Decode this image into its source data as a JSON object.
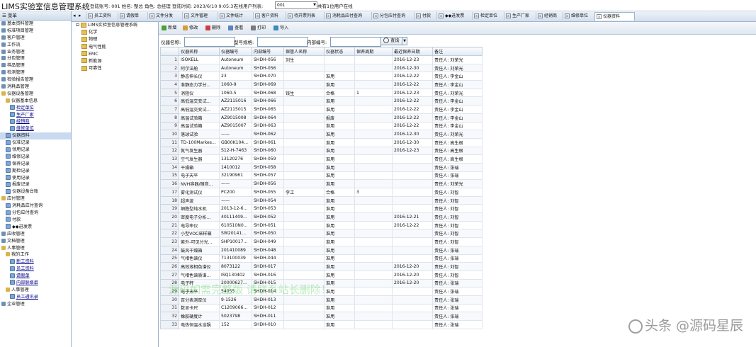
{
  "app": {
    "title": "LIMS实验室信息管理系统",
    "user_info": "登陆账号: 001 姓名: 整总 角色: 总经理 登陆时间: 2023/6/10 9:05:37",
    "online_label": "在线用户列表:",
    "online_selected": "001",
    "online_count": "共有1位用户在线"
  },
  "sidebar": {
    "header": "菜单",
    "items": [
      {
        "label": "基本资料管理",
        "level": 1,
        "icon": "database-icon"
      },
      {
        "label": "标准项目管理",
        "level": 1,
        "icon": "database-icon"
      },
      {
        "label": "客户管理",
        "level": 1,
        "icon": "database-icon"
      },
      {
        "label": "工作流",
        "level": 1,
        "icon": "database-icon"
      },
      {
        "label": "业务管理",
        "level": 1,
        "icon": "database-icon"
      },
      {
        "label": "分包管理",
        "level": 1,
        "icon": "database-icon"
      },
      {
        "label": "样品管理",
        "level": 1,
        "icon": "database-icon"
      },
      {
        "label": "检测管理",
        "level": 1,
        "icon": "database-icon"
      },
      {
        "label": "检验报告管理",
        "level": 1,
        "icon": "database-icon"
      },
      {
        "label": "消耗品管理",
        "level": 1,
        "icon": "database-icon"
      },
      {
        "label": "仪器设备管理",
        "level": 1,
        "icon": "folder-open-icon"
      },
      {
        "label": "仪器基本信息",
        "level": 2,
        "icon": "folder-open-icon"
      },
      {
        "label": "检定单位",
        "level": 3,
        "icon": "document-icon"
      },
      {
        "label": "生产厂家",
        "level": 3,
        "icon": "document-icon"
      },
      {
        "label": "经销商",
        "level": 3,
        "icon": "document-icon"
      },
      {
        "label": "维修单位",
        "level": 3,
        "icon": "document-icon"
      },
      {
        "label": "仪器资料",
        "level": 2,
        "icon": "document-icon",
        "selected": true
      },
      {
        "label": "仪准记录",
        "level": 2,
        "icon": "document-icon"
      },
      {
        "label": "领用记录",
        "level": 2,
        "icon": "document-icon"
      },
      {
        "label": "维修记录",
        "level": 2,
        "icon": "document-icon"
      },
      {
        "label": "保养记录",
        "level": 2,
        "icon": "document-icon"
      },
      {
        "label": "期检记录",
        "level": 2,
        "icon": "document-icon"
      },
      {
        "label": "使用记录",
        "level": 2,
        "icon": "document-icon"
      },
      {
        "label": "报废记录",
        "level": 2,
        "icon": "document-icon"
      },
      {
        "label": "仪器设备台账",
        "level": 2,
        "icon": "document-icon"
      },
      {
        "label": "应付管理",
        "level": 1,
        "icon": "folder-open-icon"
      },
      {
        "label": "消耗品应付查询",
        "level": 2,
        "icon": "document-icon"
      },
      {
        "label": "分包应付查询",
        "level": 2,
        "icon": "document-icon"
      },
      {
        "label": "付款",
        "level": 2,
        "icon": "document-icon"
      },
      {
        "label": "◆◆进发票",
        "level": 2,
        "icon": "document-icon"
      },
      {
        "label": "应收管理",
        "level": 1,
        "icon": "database-icon"
      },
      {
        "label": "文档管理",
        "level": 1,
        "icon": "database-icon"
      },
      {
        "label": "人事管理",
        "level": 1,
        "icon": "folder-open-icon"
      },
      {
        "label": "我的工作",
        "level": 2,
        "icon": "folder-open-icon"
      },
      {
        "label": "新工资料",
        "level": 3,
        "icon": "document-icon"
      },
      {
        "label": "员工资料",
        "level": 3,
        "icon": "document-icon"
      },
      {
        "label": "请假单",
        "level": 3,
        "icon": "document-icon"
      },
      {
        "label": "内部联络单",
        "level": 3,
        "icon": "document-icon"
      },
      {
        "label": "人事管理",
        "level": 2,
        "icon": "folder-closed-icon"
      },
      {
        "label": "员工通讯录",
        "level": 3,
        "icon": "document-icon"
      },
      {
        "label": "企业管理",
        "level": 1,
        "icon": "database-icon"
      }
    ]
  },
  "tabs": [
    {
      "label": "员工资料"
    },
    {
      "label": "请假单"
    },
    {
      "label": "文件分发"
    },
    {
      "label": "文件管理"
    },
    {
      "label": "文件统计"
    },
    {
      "label": "客户资料"
    },
    {
      "label": "待开票列表"
    },
    {
      "label": "消耗品应付查询"
    },
    {
      "label": "分包应付查询"
    },
    {
      "label": "付款"
    },
    {
      "label": "◆◆进发票"
    },
    {
      "label": "检定单位"
    },
    {
      "label": "生产厂家"
    },
    {
      "label": "经销商"
    },
    {
      "label": "维修单位"
    },
    {
      "label": "仪器资料",
      "active": true
    }
  ],
  "tree": {
    "root": "LIMS实验室信息管理系统",
    "children": [
      "化学",
      "物理",
      "电气性能",
      "EMC",
      "新能源",
      "可靠性"
    ]
  },
  "toolbar": {
    "new": "新增",
    "edit": "修改",
    "delete": "删除",
    "view": "查看",
    "print": "打印",
    "import": "导入"
  },
  "filter": {
    "name_label": "仪器名称:",
    "model_label": "型号规格:",
    "internal_label": "内部编号:",
    "query_button": "查询",
    "name_value": "",
    "model_value": "",
    "internal_value": ""
  },
  "table": {
    "columns": [
      "",
      "仪器名称",
      "仪器编号",
      "内部编号",
      "保管人名称",
      "仪器状态",
      "保养周期",
      "最近保养日期",
      "备注"
    ],
    "rows": [
      [
        "1",
        "ISOKELL",
        "Autoneum",
        "SHDH-056",
        "刘生",
        "",
        "",
        "2016-12-23",
        "责任人: 刘荣光"
      ],
      [
        "2",
        "阿尔法舱",
        "Autoneum",
        "SHDH-056",
        "",
        "",
        "",
        "2016-12-30",
        "责任人: 刘荣光"
      ],
      [
        "3",
        "静态伸长仪",
        "23",
        "SHDH-070",
        "",
        "准用",
        "",
        "2016-12-22",
        "责任人: 李金山"
      ],
      [
        "4",
        "准静态力学分...",
        "1060-9",
        "SHDH-069",
        "",
        "准用",
        "",
        "2016-12-22",
        "责任人: 李金山"
      ],
      [
        "5",
        "消阻仪",
        "1060-5",
        "SHDH-068",
        "钱生",
        "合格",
        "1",
        "2016-12-23",
        "责任人: 刘荣光"
      ],
      [
        "6",
        "高低温交变试...",
        "AZ2115016",
        "SHDH-066",
        "",
        "准用",
        "",
        "2016-12-22",
        "责任人: 李金山"
      ],
      [
        "7",
        "高低温交变试...",
        "AZ2115015",
        "SHDH-065",
        "",
        "准用",
        "",
        "2016-12-22",
        "责任人: 李金山"
      ],
      [
        "8",
        "高温试验箱",
        "AZ9015008",
        "SHDH-064",
        "",
        "报废",
        "",
        "2016-12-22",
        "责任人: 李金山"
      ],
      [
        "9",
        "高温试验箱",
        "AZ9015007",
        "SHDH-063",
        "",
        "准用",
        "",
        "2016-12-22",
        "责任人: 李金山"
      ],
      [
        "10",
        "落球试验",
        "——",
        "SHDH-062",
        "",
        "准用",
        "",
        "2016-12-30",
        "责任人: 刘荣光"
      ],
      [
        "11",
        "TD-100Markes...",
        "GB00K104...",
        "SHDH-061",
        "",
        "准用",
        "",
        "2016-12-30",
        "责任人: 高生根"
      ],
      [
        "12",
        "氮气发生器",
        "S12-H-7463",
        "SHDH-060",
        "",
        "准用",
        "",
        "2016-12-23",
        "责任人: 高生根"
      ],
      [
        "13",
        "空气发生器",
        "13120276",
        "SHDH-059",
        "",
        "准用",
        "",
        "",
        "责任人: 高生根"
      ],
      [
        "14",
        "干燥箱",
        "1410012",
        "SHDH-058",
        "",
        "准用",
        "",
        "",
        "责任人: 张瑞"
      ],
      [
        "15",
        "电子天平",
        "32190961",
        "SHDH-057",
        "",
        "准用",
        "",
        "",
        "责任人: 张瑞"
      ],
      [
        "16",
        "NVH容器/随音...",
        "——",
        "SHDH-056",
        "",
        "准用",
        "",
        "",
        "责任人: 刘荣光"
      ],
      [
        "17",
        "雾化测试仪",
        "PC200",
        "SHDH-055",
        "李工",
        "合格",
        "3",
        "",
        "责任人: 刘智"
      ],
      [
        "18",
        "超声波",
        "——",
        "SHDH-054",
        "",
        "准用",
        "",
        "",
        "责任人: 刘智"
      ],
      [
        "19",
        "细胞型纯水机",
        "2013-12-6...",
        "SHDH-053",
        "",
        "准用",
        "",
        "",
        "责任人: 刘智"
      ],
      [
        "20",
        "密度电子分析...",
        "40111409...",
        "SHDH-052",
        "",
        "准用",
        "",
        "2016-12-21",
        "责任人: 刘智"
      ],
      [
        "21",
        "电导率仪",
        "610510N0...",
        "SHDH-051",
        "",
        "准用",
        "",
        "2016-12-22",
        "责任人: 刘智"
      ],
      [
        "22",
        "小型VOC采样箱",
        "SW20141...",
        "SHDH-050",
        "",
        "准用",
        "",
        "",
        "责任人: 刘智"
      ],
      [
        "23",
        "紫外-可见分光...",
        "SHP10017...",
        "SHDH-049",
        "",
        "准用",
        "",
        "",
        "责任人: 刘智"
      ],
      [
        "24",
        "鼓风干燥箱",
        "201410089",
        "SHDH-048",
        "",
        "准用",
        "",
        "",
        "责任人: 张瑞"
      ],
      [
        "25",
        "气相色谱仪",
        "713100039",
        "SHDH-044",
        "",
        "准用",
        "",
        "",
        "责任人: 张瑞"
      ],
      [
        "26",
        "高效液相色谱仪",
        "8073122",
        "SHDH-017",
        "",
        "准用",
        "",
        "2016-12-20",
        "责任人: 刘智"
      ],
      [
        "27",
        "气相色谱质谱...",
        "ISQ130402",
        "SHDH-016",
        "",
        "准用",
        "",
        "2016-12-20",
        "责任人: 刘智"
      ],
      [
        "28",
        "电子秤",
        "20000627...",
        "SHDH-015",
        "",
        "准用",
        "",
        "2016-12-20",
        "责任人: 张瑞"
      ],
      [
        "29",
        "电子天平",
        "54055",
        "SHDH-014",
        "",
        "准用",
        "",
        "",
        "责任人: 张瑞"
      ],
      [
        "30",
        "百分表测厚仪",
        "9-1526",
        "SHDH-013",
        "",
        "准用",
        "",
        "",
        "责任人: 张瑞"
      ],
      [
        "31",
        "数显卡尺",
        "C1209066...",
        "SHDH-012",
        "",
        "准用",
        "",
        "",
        "责任人: 张瑞"
      ],
      [
        "32",
        "橡胶硬度计",
        "5023798",
        "SHDH-011",
        "",
        "准用",
        "",
        "",
        "责任人: 张瑞"
      ],
      [
        "33",
        "电热恒温水浴锅",
        "152",
        "SHDH-010",
        "",
        "准用",
        "",
        "",
        "责任人: 张瑞"
      ]
    ]
  },
  "watermarks": {
    "overlay": "源码如需完整版 请联系站长删除！",
    "brand": "头条 @源码星辰"
  }
}
